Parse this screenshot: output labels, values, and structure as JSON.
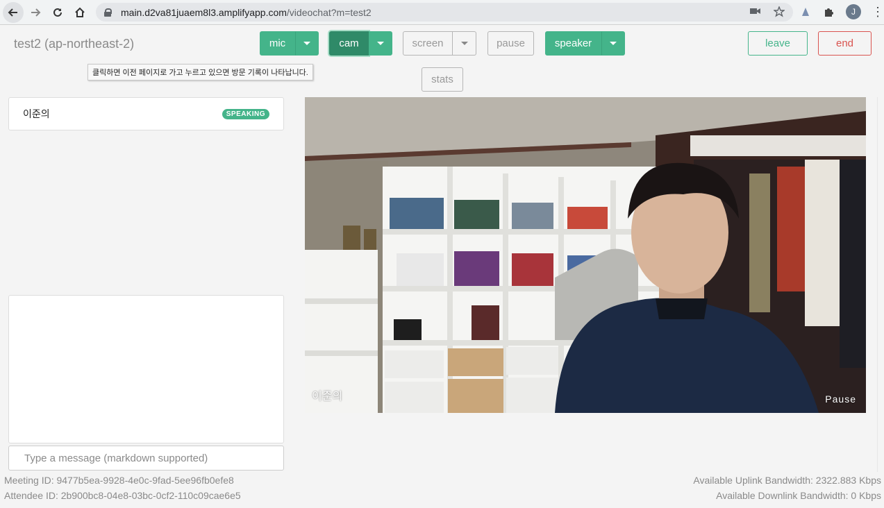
{
  "browser": {
    "url_host": "main.d2va81juaem8l3.amplifyapp.com",
    "url_path": "/videochat?m=test2",
    "profile_initial": "J"
  },
  "header": {
    "room_title": "test2 (ap-northeast-2)",
    "mic_label": "mic",
    "cam_label": "cam",
    "screen_label": "screen",
    "pause_label": "pause",
    "speaker_label": "speaker",
    "stats_label": "stats",
    "leave_label": "leave",
    "end_label": "end",
    "accent_color": "#44b48a",
    "danger_color": "#d9534f"
  },
  "tooltip": {
    "text": "클릭하면 이전 페이지로 가고 누르고 있으면 방문 기록이 나타납니다."
  },
  "roster": {
    "name": "이준의",
    "status": "SPEAKING"
  },
  "chat": {
    "placeholder": "Type a message (markdown supported)"
  },
  "video": {
    "name": "이준의",
    "status": "Pause"
  },
  "footer": {
    "meeting_id": "Meeting ID: 9477b5ea-9928-4e0c-9fad-5ee96fb0efe8",
    "attendee_id": "Attendee ID: 2b900bc8-04e8-03bc-0cf2-110c09cae6e5",
    "uplink": "Available Uplink Bandwidth: 2322.883 Kbps",
    "downlink": "Available Downlink Bandwidth: 0 Kbps"
  }
}
